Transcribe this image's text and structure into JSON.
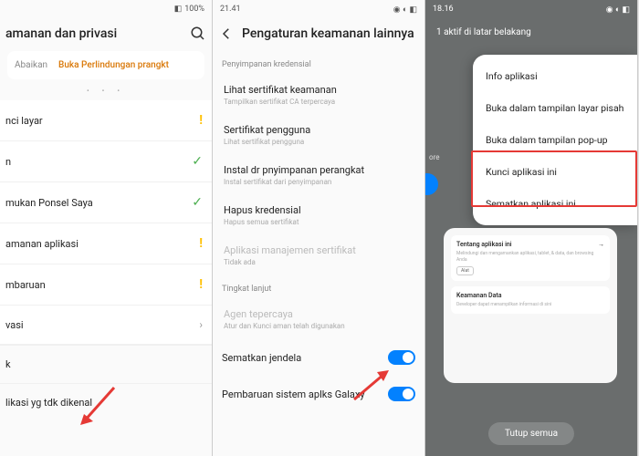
{
  "screen1": {
    "status": {
      "time": "",
      "battery": "100%"
    },
    "title": "amanan dan privasi",
    "banner": {
      "btn1": "Abaikan",
      "btn2": "Buka Perlindungan prangkt"
    },
    "items": [
      {
        "label": "nci layar",
        "status": "warn"
      },
      {
        "label": "n",
        "status": "check"
      },
      {
        "label": "mukan Ponsel Saya",
        "status": "check"
      },
      {
        "label": "amanan aplikasi",
        "status": "warn"
      },
      {
        "label": "mbaruan",
        "status": "warn"
      },
      {
        "label": "vasi",
        "status": "chevron"
      }
    ],
    "bottom1": "k",
    "bottom2": "likasi yg tdk dikenal"
  },
  "screen2": {
    "status": {
      "time": "21.41",
      "battery": ""
    },
    "title": "Pengaturan keamanan lainnya",
    "section1": "Penyimpanan kredensial",
    "items": [
      {
        "title": "Lihat sertifikat keamanan",
        "sub": "Tampilkan sertifikat CA terpercaya"
      },
      {
        "title": "Sertifikat pengguna",
        "sub": "Lihat sertifikat pengguna"
      },
      {
        "title": "Instal dr pnyimpanan perangkat",
        "sub": "Instal sertifikat dari penyimpanan"
      },
      {
        "title": "Hapus kredensial",
        "sub": "Hapus semua sertifikat"
      },
      {
        "title": "Aplikasi manajemen sertifikat",
        "sub": "Tidak ada",
        "disabled": true
      }
    ],
    "section2": "Tingkat lanjut",
    "advanced": [
      {
        "title": "Agen tepercaya",
        "sub": "Atur dan Kunci aman telah digunakan",
        "disabled": true
      }
    ],
    "toggles": [
      {
        "label": "Sematkan jendela"
      },
      {
        "label": "Pembaruan sistem aplks Galaxy"
      }
    ]
  },
  "screen3": {
    "status": {
      "time": "18.16",
      "battery": ""
    },
    "header": "1 aktif di latar belakang",
    "side_label": "ore",
    "popup": [
      "Info aplikasi",
      "Buka dalam tampilan layar pisah",
      "Buka dalam tampilan pop-up",
      "Kunci aplikasi ini",
      "Sematkan aplikasi ini"
    ],
    "card": {
      "title": "Tentang aplikasi ini",
      "desc": "Melindungi dan mengamankan aplikasi, tablet, & data, dan browsing Anda",
      "pill": "Alat",
      "section2": "Keamanan Data",
      "desc2": "Developer dapat menampilkan informasi di sini"
    },
    "close_all": "Tutup semua"
  }
}
